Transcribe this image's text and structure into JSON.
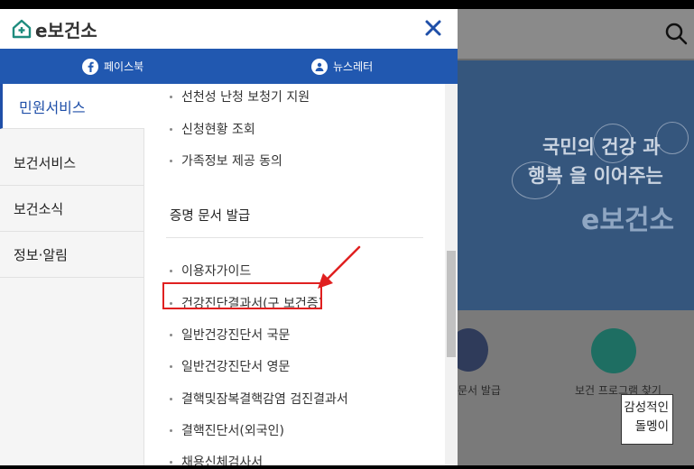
{
  "logo": {
    "text": "e보건소"
  },
  "social": {
    "facebook": "페이스북",
    "newsletter": "뉴스레터"
  },
  "nav": {
    "items": [
      {
        "label": "민원서비스",
        "active": true
      },
      {
        "label": "보건서비스",
        "active": false
      },
      {
        "label": "보건소식",
        "active": false
      },
      {
        "label": "정보·알림",
        "active": false
      }
    ]
  },
  "content": {
    "items_top": [
      "선천성 난청 보청기 지원",
      "신청현황 조회",
      "가족정보 제공 동의"
    ],
    "section_title": "증명 문서 발급",
    "items_section": [
      "이용자가이드",
      "건강진단결과서(구 보건증)",
      "일반건강진단서 국문",
      "일반건강진단서 영문",
      "결핵및잠복결핵감염 검진결과서",
      "결핵진단서(외국인)",
      "채용신체검사서"
    ]
  },
  "background": {
    "banner_line1": "국민의 건강 과",
    "banner_line2": "행복 을 이어주는",
    "banner_brand": "e보건소",
    "quick_link1": "문서 발급",
    "quick_link2": "보건 프로그램 찾기"
  },
  "watermark": {
    "line1": "감성적인",
    "line2": "돌멩이"
  },
  "colors": {
    "brand_blue": "#2158b0",
    "active_nav": "#1f4fa8",
    "highlight_red": "#e02020"
  }
}
